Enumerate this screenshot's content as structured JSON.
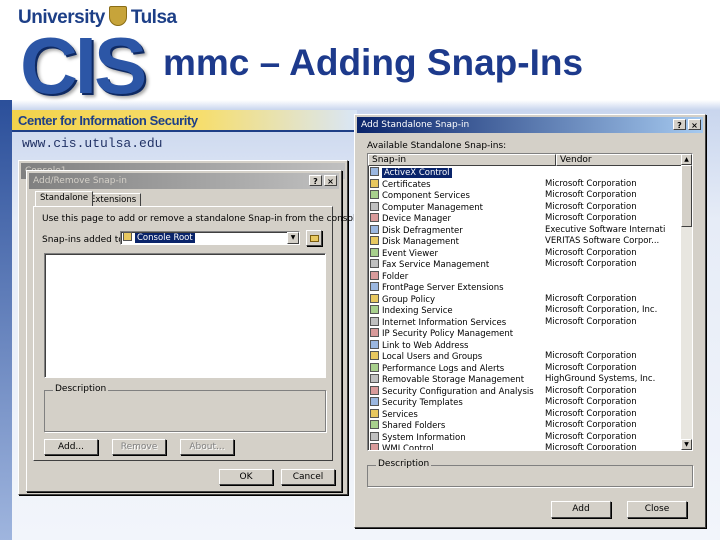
{
  "branding": {
    "university_left": "University",
    "university_right": "Tulsa",
    "logo": "CIS",
    "center_name": "Center for Information Security",
    "url": "www.cis.utulsa.edu"
  },
  "slide": {
    "title": "mmc – Adding Snap-Ins"
  },
  "console_window": {
    "title": "Console1"
  },
  "add_remove_dialog": {
    "title": "Add/Remove Snap-in",
    "help_btn": "?",
    "close_btn": "×",
    "tabs": [
      "Standalone",
      "Extensions"
    ],
    "instruction": "Use this page to add or remove a standalone Snap-in from the console.",
    "snapins_added_label": "Snap-ins added to:",
    "snapins_added_value": "Console Root",
    "description_label": "Description",
    "buttons": {
      "add": "Add...",
      "remove": "Remove",
      "about": "About...",
      "ok": "OK",
      "cancel": "Cancel"
    }
  },
  "standalone_dialog": {
    "title": "Add Standalone Snap-in",
    "help_btn": "?",
    "close_btn": "×",
    "available_label": "Available Standalone Snap-ins:",
    "columns": {
      "snapin": "Snap-in",
      "vendor": "Vendor"
    },
    "items": [
      {
        "name": "ActiveX Control",
        "vendor": ""
      },
      {
        "name": "Certificates",
        "vendor": "Microsoft Corporation"
      },
      {
        "name": "Component Services",
        "vendor": "Microsoft Corporation"
      },
      {
        "name": "Computer Management",
        "vendor": "Microsoft Corporation"
      },
      {
        "name": "Device Manager",
        "vendor": "Microsoft Corporation"
      },
      {
        "name": "Disk Defragmenter",
        "vendor": "Executive Software Internati..."
      },
      {
        "name": "Disk Management",
        "vendor": "VERITAS Software Corpor..."
      },
      {
        "name": "Event Viewer",
        "vendor": "Microsoft Corporation"
      },
      {
        "name": "Fax Service Management",
        "vendor": "Microsoft Corporation"
      },
      {
        "name": "Folder",
        "vendor": ""
      },
      {
        "name": "FrontPage Server Extensions",
        "vendor": ""
      },
      {
        "name": "Group Policy",
        "vendor": "Microsoft Corporation"
      },
      {
        "name": "Indexing Service",
        "vendor": "Microsoft Corporation, Inc."
      },
      {
        "name": "Internet Information Services",
        "vendor": "Microsoft Corporation"
      },
      {
        "name": "IP Security Policy Management",
        "vendor": ""
      },
      {
        "name": "Link to Web Address",
        "vendor": ""
      },
      {
        "name": "Local Users and Groups",
        "vendor": "Microsoft Corporation"
      },
      {
        "name": "Performance Logs and Alerts",
        "vendor": "Microsoft Corporation"
      },
      {
        "name": "Removable Storage Management",
        "vendor": "HighGround Systems, Inc."
      },
      {
        "name": "Security Configuration and Analysis",
        "vendor": "Microsoft Corporation"
      },
      {
        "name": "Security Templates",
        "vendor": "Microsoft Corporation"
      },
      {
        "name": "Services",
        "vendor": "Microsoft Corporation"
      },
      {
        "name": "Shared Folders",
        "vendor": "Microsoft Corporation"
      },
      {
        "name": "System Information",
        "vendor": "Microsoft Corporation"
      },
      {
        "name": "WMI Control",
        "vendor": "Microsoft Corporation"
      }
    ],
    "description_label": "Description",
    "buttons": {
      "add": "Add",
      "close": "Close"
    }
  },
  "colors": {
    "title_blue": "#1d3a8c",
    "banner_gold": "#f2d24b",
    "selection": "#0a246a"
  }
}
